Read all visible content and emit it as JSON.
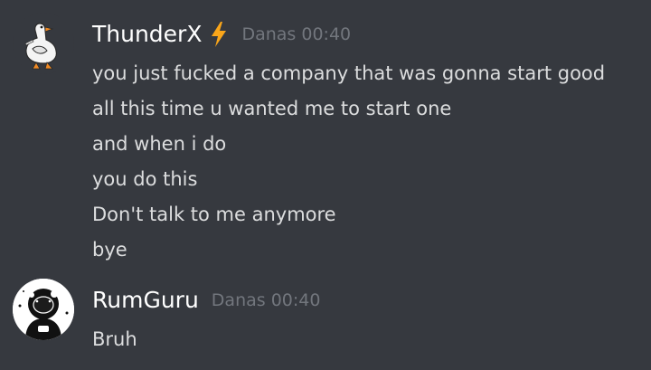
{
  "messages": [
    {
      "username": "ThunderX",
      "badge_icon": "lightning-bolt-icon",
      "badge_color": "#faa61a",
      "timestamp": "Danas 00:40",
      "avatar_icon": "goose-icon",
      "lines": [
        "you just fucked a company that was gonna start good",
        "all this time u wanted me to start one",
        "and when i do",
        "you do this",
        "Don't talk to me anymore",
        "bye"
      ]
    },
    {
      "username": "RumGuru",
      "timestamp": "Danas 00:40",
      "avatar_icon": "astronaut-icon",
      "lines": [
        "Bruh"
      ]
    }
  ],
  "colors": {
    "background": "#36393f",
    "username": "#ffffff",
    "timestamp": "#72767d",
    "message_text": "#dcddde"
  }
}
